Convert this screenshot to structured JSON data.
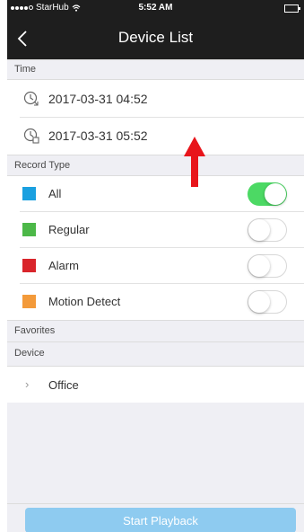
{
  "status_bar": {
    "carrier": "StarHub",
    "time": "5:52 AM"
  },
  "nav": {
    "title": "Device List"
  },
  "sections": {
    "time": "Time",
    "record_type": "Record Type",
    "favorites": "Favorites",
    "device": "Device"
  },
  "time": {
    "start": "2017-03-31 04:52",
    "end": "2017-03-31 05:52",
    "start_icon": "clock-start-icon",
    "end_icon": "clock-end-icon"
  },
  "record_types": [
    {
      "label": "All",
      "color": "#1aa0e0",
      "enabled": true
    },
    {
      "label": "Regular",
      "color": "#4cb848",
      "enabled": false
    },
    {
      "label": "Alarm",
      "color": "#d9252b",
      "enabled": false
    },
    {
      "label": "Motion Detect",
      "color": "#f39a3a",
      "enabled": false
    }
  ],
  "devices": [
    {
      "label": "Office"
    }
  ],
  "footer": {
    "playback_label": "Start Playback"
  },
  "colors": {
    "accent": "#4cd964",
    "button": "#8ecbf0",
    "annotation_arrow": "#e8151b"
  }
}
